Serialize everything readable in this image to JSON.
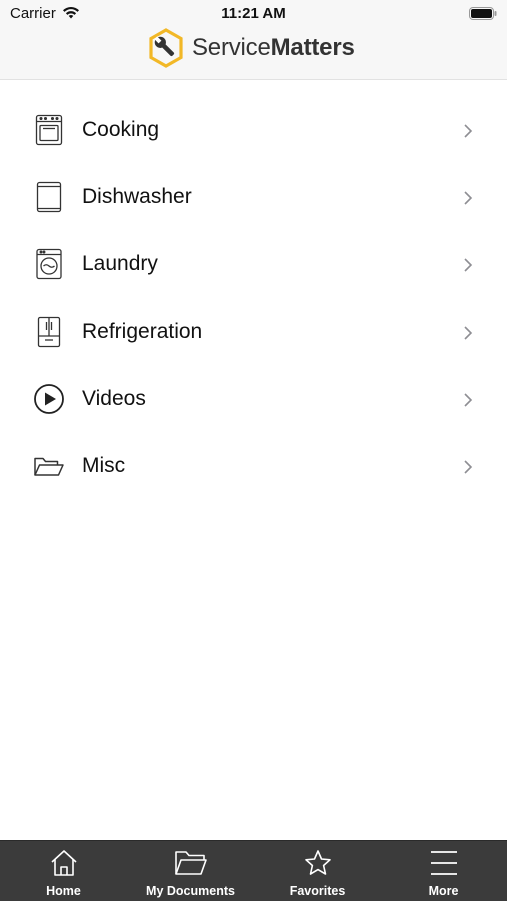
{
  "status_bar": {
    "carrier": "Carrier",
    "time": "11:21 AM"
  },
  "header": {
    "brand_light": "Service",
    "brand_bold": "Matters",
    "logo_color": "#F2B827"
  },
  "menu": [
    {
      "label": "Cooking",
      "icon": "oven-icon"
    },
    {
      "label": "Dishwasher",
      "icon": "dishwasher-icon"
    },
    {
      "label": "Laundry",
      "icon": "washing-machine-icon"
    },
    {
      "label": "Refrigeration",
      "icon": "refrigerator-icon"
    },
    {
      "label": "Videos",
      "icon": "play-circle-icon"
    },
    {
      "label": "Misc",
      "icon": "folder-open-icon"
    }
  ],
  "tab_bar": {
    "background": "#3b3b3b",
    "tabs": [
      {
        "label": "Home",
        "icon": "home-icon"
      },
      {
        "label": "My Documents",
        "icon": "folder-icon"
      },
      {
        "label": "Favorites",
        "icon": "star-icon"
      },
      {
        "label": "More",
        "icon": "hamburger-menu-icon"
      }
    ]
  }
}
